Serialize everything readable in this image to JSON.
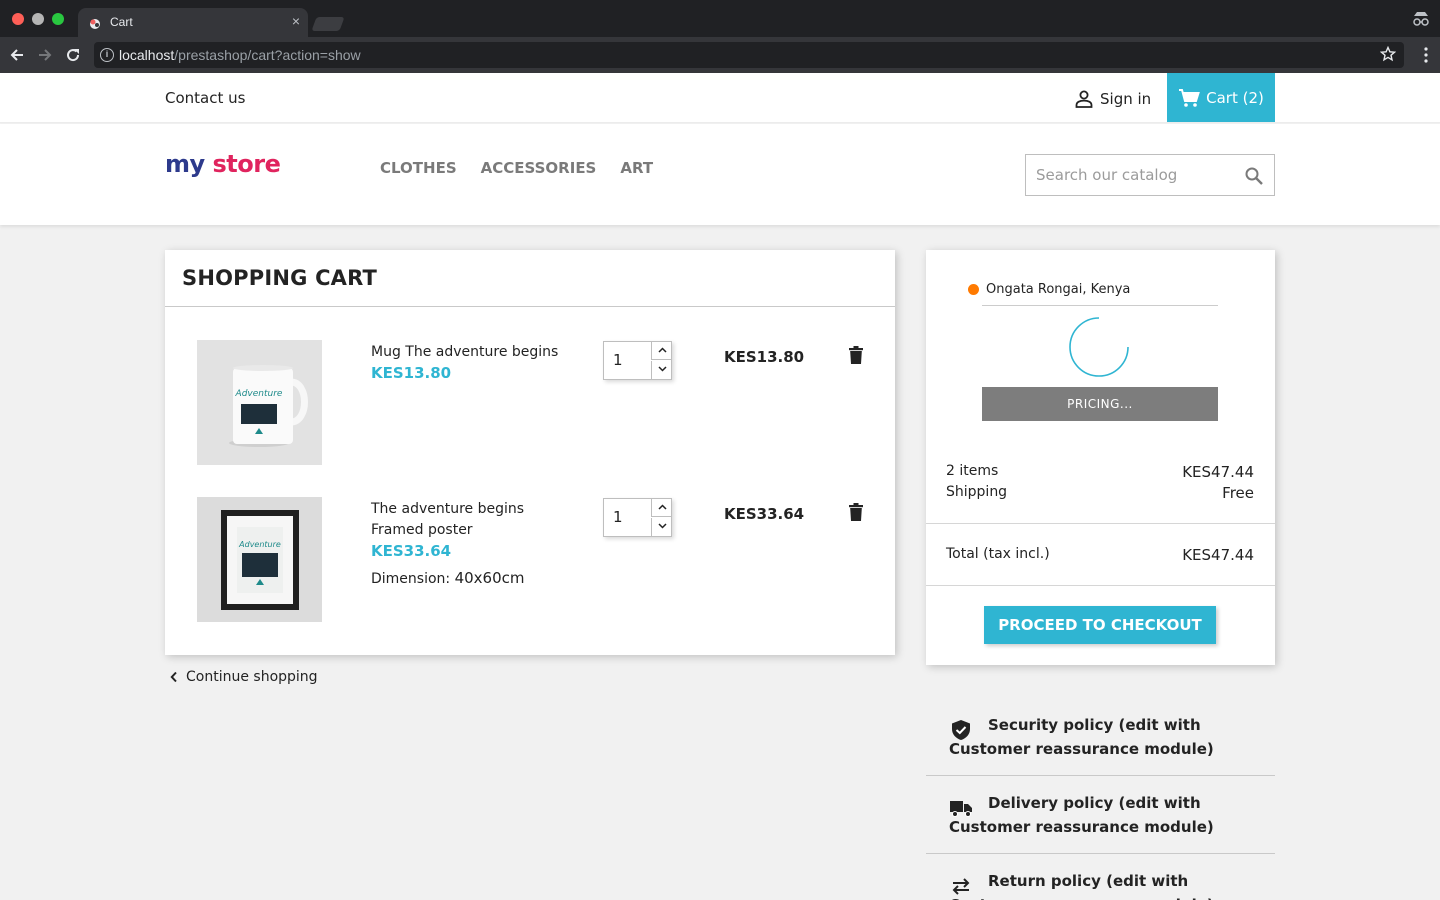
{
  "browser": {
    "tab_title": "Cart",
    "tab_close": "×",
    "url_host": "localhost",
    "url_path": "/prestashop/cart?action=show"
  },
  "header": {
    "contact": "Contact us",
    "signin": "Sign in",
    "cart": "Cart (2)"
  },
  "logo": {
    "part1": "my",
    "part2": "store"
  },
  "nav": [
    "CLOTHES",
    "ACCESSORIES",
    "ART"
  ],
  "search": {
    "placeholder": "Search our catalog"
  },
  "cart": {
    "title": "SHOPPING CART",
    "lines": [
      {
        "name": "Mug The adventure begins",
        "price": "KES13.80",
        "qty": "1",
        "total": "KES13.80",
        "attr_label": "",
        "attr_value": ""
      },
      {
        "name": "The adventure begins Framed poster",
        "price": "KES33.64",
        "qty": "1",
        "total": "KES33.64",
        "attr_label": "Dimension:",
        "attr_value": "40x60cm"
      }
    ],
    "continue": "Continue shopping"
  },
  "summary": {
    "location": "Ongata Rongai, Kenya",
    "pricing": "PRICING...",
    "items_label": "2 items",
    "items_value": "KES47.44",
    "shipping_label": "Shipping",
    "shipping_value": "Free",
    "total_label": "Total (tax incl.)",
    "total_value": "KES47.44",
    "checkout": "PROCEED TO CHECKOUT"
  },
  "reassurance": [
    {
      "icon": "shield-icon",
      "text": "Security policy (edit with Customer reassurance module)"
    },
    {
      "icon": "truck-icon",
      "text": "Delivery policy (edit with Customer reassurance module)"
    },
    {
      "icon": "swap-arrows-icon",
      "text": "Return policy (edit with Customer reassurance module)"
    }
  ],
  "colors": {
    "accent": "#2fb5d2",
    "location_dot": "#ff7a00",
    "pricing_bg": "#7d7d7d"
  }
}
